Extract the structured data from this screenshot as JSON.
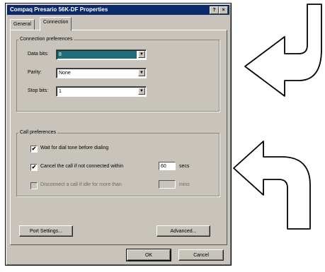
{
  "window": {
    "title": "Compaq Presario 56K-DF Properties",
    "help_button": "?",
    "close_button": "×"
  },
  "tabs": [
    {
      "label": "General"
    },
    {
      "label": "Connection"
    }
  ],
  "connection_preferences": {
    "group_label": "Connection preferences",
    "data_bits": {
      "label": "Data bits:",
      "value": "8"
    },
    "parity": {
      "label": "Parity:",
      "value": "None"
    },
    "stop_bits": {
      "label": "Stop bits:",
      "value": "1"
    }
  },
  "call_preferences": {
    "group_label": "Call preferences",
    "wait_dial_tone": {
      "label": "Wait for dial tone before dialing",
      "checked": true
    },
    "cancel_call": {
      "label": "Cancel the call if not connected within",
      "checked": true,
      "value": "60",
      "unit": "secs"
    },
    "disconnect_idle": {
      "label": "Disconnect a call if idle for more than",
      "checked": false,
      "value": "",
      "unit": "mins"
    }
  },
  "buttons": {
    "port_settings": "Port Settings...",
    "advanced": "Advanced...",
    "ok": "OK",
    "cancel": "Cancel"
  },
  "check_glyph": "✔",
  "arrow_glyph": "▼"
}
